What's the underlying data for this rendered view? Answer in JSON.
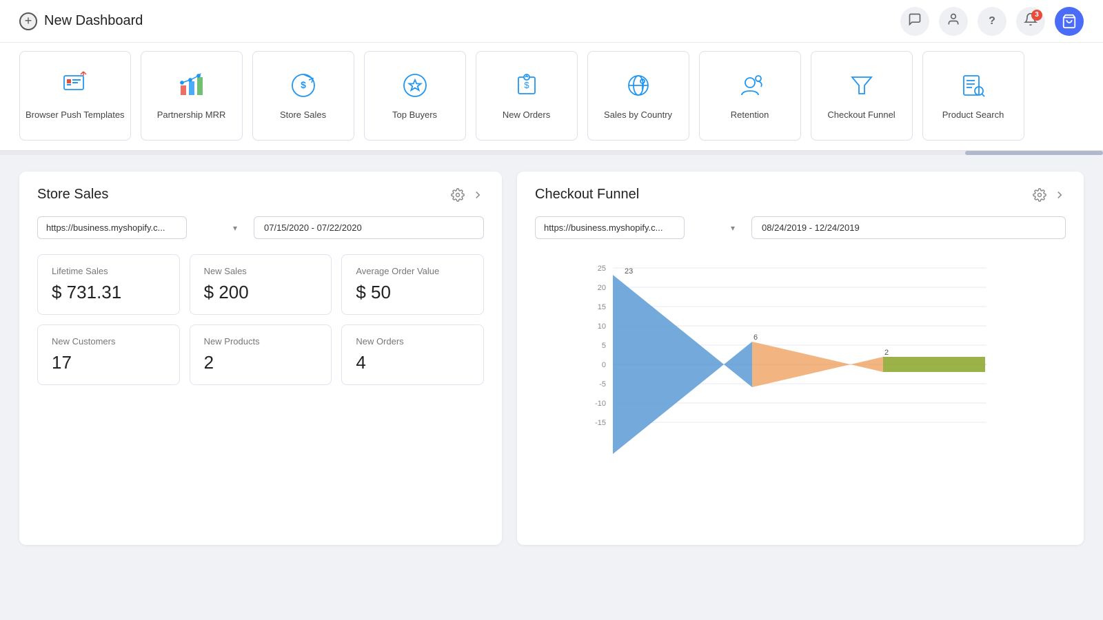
{
  "header": {
    "add_label": "+",
    "title": "New Dashboard",
    "icons": {
      "chat": "💬",
      "user": "👤",
      "help": "?",
      "notification": "🔔",
      "notification_count": "3",
      "avatar": "🛒"
    }
  },
  "carousel": {
    "items": [
      {
        "id": "browser-push",
        "label": "Browser Push Templates",
        "icon": "browser-push-icon"
      },
      {
        "id": "partnership-mrr",
        "label": "Partnership MRR",
        "icon": "partnership-mrr-icon"
      },
      {
        "id": "store-sales",
        "label": "Store Sales",
        "icon": "store-sales-icon"
      },
      {
        "id": "top-buyers",
        "label": "Top Buyers",
        "icon": "top-buyers-icon"
      },
      {
        "id": "new-orders",
        "label": "New Orders",
        "icon": "new-orders-icon"
      },
      {
        "id": "sales-by-country",
        "label": "Sales by Country",
        "icon": "sales-by-country-icon"
      },
      {
        "id": "retention",
        "label": "Retention",
        "icon": "retention-icon"
      },
      {
        "id": "checkout-funnel",
        "label": "Checkout Funnel",
        "icon": "checkout-funnel-icon"
      },
      {
        "id": "product-search",
        "label": "Product Search",
        "icon": "product-search-icon"
      }
    ]
  },
  "store_sales_panel": {
    "title": "Store Sales",
    "filter_url": "https://business.myshopify.c...",
    "filter_date": "07/15/2020 - 07/22/2020",
    "stats": [
      {
        "label": "Lifetime Sales",
        "value": "$ 731.31"
      },
      {
        "label": "New Sales",
        "value": "$ 200"
      },
      {
        "label": "Average Order Value",
        "value": "$ 50"
      },
      {
        "label": "New Customers",
        "value": "17"
      },
      {
        "label": "New Products",
        "value": "2"
      },
      {
        "label": "New Orders",
        "value": "4"
      }
    ]
  },
  "checkout_funnel_panel": {
    "title": "Checkout Funnel",
    "filter_url": "https://business.myshopify.c...",
    "filter_date": "08/24/2019 - 12/24/2019",
    "chart": {
      "y_axis": [
        25,
        20,
        15,
        10,
        5,
        0,
        -5,
        -10,
        -15
      ],
      "labels": [
        "23",
        "6",
        "2"
      ],
      "colors": [
        "#5b9bd5",
        "#f0a86b",
        "#8faa33"
      ],
      "segments": [
        {
          "value": 23,
          "color": "#5b9bd5"
        },
        {
          "value": 6,
          "color": "#f0a86b"
        },
        {
          "value": 2,
          "color": "#8faa33"
        }
      ]
    }
  }
}
